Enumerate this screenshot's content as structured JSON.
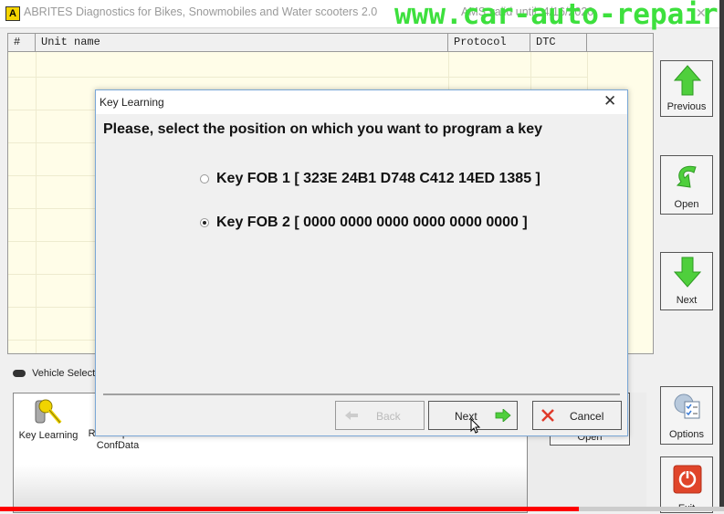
{
  "window": {
    "app_icon": "A",
    "title": "ABRITES Diagnostics for Bikes, Snowmobiles and Water scooters 2.0",
    "validity": "AMS valid until: 4/16/2020",
    "watermark": "www.car-auto-repair.co"
  },
  "grid": {
    "columns": [
      "#",
      "Unit name",
      "Protocol",
      "DTC",
      ""
    ]
  },
  "side_buttons": {
    "previous": "Previous",
    "open": "Open",
    "next": "Next",
    "options": "Options",
    "exit": "Exit"
  },
  "lower": {
    "vehicle_tab": "Vehicle Selecti",
    "tools": [
      {
        "label": "Key Learning",
        "icon": "key-icon"
      },
      {
        "label": "Read/Update ConfData",
        "icon": "confdata-icon"
      }
    ],
    "open_button": "Open"
  },
  "dialog": {
    "title": "Key Learning",
    "heading": "Please, select the position on which you want to program a key",
    "options": [
      {
        "label": "Key FOB 1 [ 323E 24B1 D748 C412 14ED 1385 ]",
        "checked": false
      },
      {
        "label": "Key FOB 2 [ 0000 0000 0000 0000 0000 0000 ]",
        "checked": true
      }
    ],
    "buttons": {
      "back": "Back",
      "next": "Next",
      "cancel": "Cancel"
    }
  },
  "video_progress": {
    "fraction": 0.8,
    "color": "#ff0000"
  }
}
